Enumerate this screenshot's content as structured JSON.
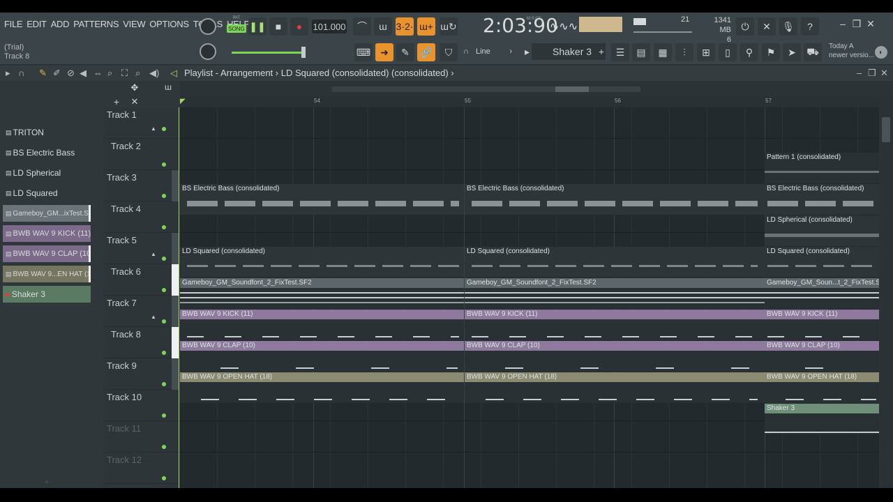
{
  "menu": [
    "FILE",
    "EDIT",
    "ADD",
    "PATTERNS",
    "VIEW",
    "OPTIONS",
    "TOOLS",
    "HELP"
  ],
  "hint": {
    "line1": "(Trial)",
    "line2": "Track 8"
  },
  "transport": {
    "mode_pat": "PAT",
    "mode_song": "SONG",
    "tempo": "101.000",
    "song_time": "2:03:90",
    "time_unit": "M:S:CS"
  },
  "status": {
    "cpu": "21",
    "memory": "1341 MB",
    "polyphony": "6"
  },
  "toolbar": {
    "line_mode": "Line",
    "selected_pattern": "Shaker 3",
    "news_line1": "Today  A",
    "news_line2": "newer versio..."
  },
  "playlist": {
    "title": "Playlist - Arrangement",
    "breadcrumb": "LD Squared (consolidated) (consolidated)"
  },
  "ruler": {
    "bar1": "54",
    "bar2": "55",
    "bar3": "56",
    "bar4": "57"
  },
  "picker": [
    {
      "label": "TRITON",
      "color": "#3a4246"
    },
    {
      "label": "BS Electric Bass",
      "color": "#3a4246"
    },
    {
      "label": "LD Spherical",
      "color": "#3a4246"
    },
    {
      "label": "LD Squared",
      "color": "#3a4246"
    },
    {
      "label": "Gameboy_GM...ixTest.SF2",
      "color": "#6b7478"
    },
    {
      "label": "BWB WAV 9 KICK (11)",
      "color": "#7c6a8a"
    },
    {
      "label": "BWB WAV 9 CLAP (10)",
      "color": "#7c6a8a"
    },
    {
      "label": "BWB WAV 9...EN HAT (18)",
      "color": "#767761"
    },
    {
      "label": "Shaker 3",
      "color": "#5a7a63"
    }
  ],
  "tracks": [
    "Track 1",
    "Track 2",
    "Track 3",
    "Track 4",
    "Track 5",
    "Track 6",
    "Track 7",
    "Track 8",
    "Track 9",
    "Track 10",
    "Track 11",
    "Track 12"
  ],
  "clips": {
    "pattern1": "Pattern 1 (consolidated)",
    "bass": "BS Electric Bass (consolidated)",
    "spherical": "LD Spherical (consolidated)",
    "squared": "LD Squared (consolidated)",
    "gameboy": "Gameboy_GM_Soundfont_2_FixTest.SF2",
    "gameboy_short": "Gameboy_GM_Soun...t_2_FixTest.SF2",
    "kick": "BWB WAV 9 KICK (11)",
    "clap": "BWB WAV 9 CLAP (10)",
    "hat": "BWB WAV 9 OPEN HAT (18)",
    "shaker": "Shaker 3"
  },
  "colors": {
    "accent_green": "#7fd55a",
    "accent_orange": "#e9932f",
    "kick_clip": "#8d7a9c",
    "hat_clip": "#8a8b72",
    "shaker_clip": "#6f8f78"
  }
}
